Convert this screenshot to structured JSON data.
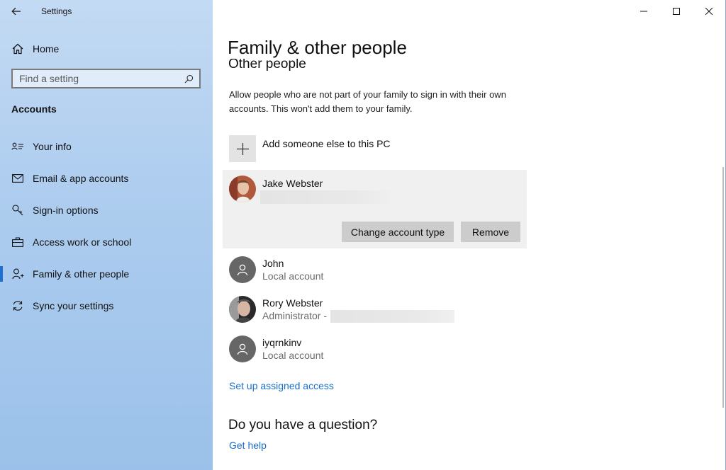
{
  "window": {
    "title": "Settings"
  },
  "sidebar": {
    "home_label": "Home",
    "search_placeholder": "Find a setting",
    "section_title": "Accounts",
    "items": [
      {
        "label": "Your info",
        "icon": "person-card-icon"
      },
      {
        "label": "Email & app accounts",
        "icon": "mail-icon"
      },
      {
        "label": "Sign-in options",
        "icon": "key-icon"
      },
      {
        "label": "Access work or school",
        "icon": "briefcase-icon"
      },
      {
        "label": "Family & other people",
        "icon": "person-add-icon",
        "selected": true
      },
      {
        "label": "Sync your settings",
        "icon": "sync-icon"
      }
    ]
  },
  "main": {
    "page_title": "Family & other people",
    "section_heading": "Other people",
    "description": "Allow people who are not part of your family to sign in with their own accounts. This won't add them to your family.",
    "add_label": "Add someone else to this PC",
    "selected_user": {
      "name": "Jake Webster",
      "change_button": "Change account type",
      "remove_button": "Remove"
    },
    "users": [
      {
        "name": "John",
        "type": "Local account"
      },
      {
        "name": "Rory Webster",
        "type": "Administrator -"
      },
      {
        "name": "iyqrnkinv",
        "type": "Local account"
      }
    ],
    "assigned_access_link": "Set up assigned access",
    "question_heading": "Do you have a question?",
    "help_link": "Get help"
  },
  "colors": {
    "accent": "#1f6fd0",
    "link": "#1a6ec9",
    "sidebar_bg": "#aecdef",
    "button_bg": "#cccccc",
    "selected_row_bg": "#f0f0f0"
  }
}
